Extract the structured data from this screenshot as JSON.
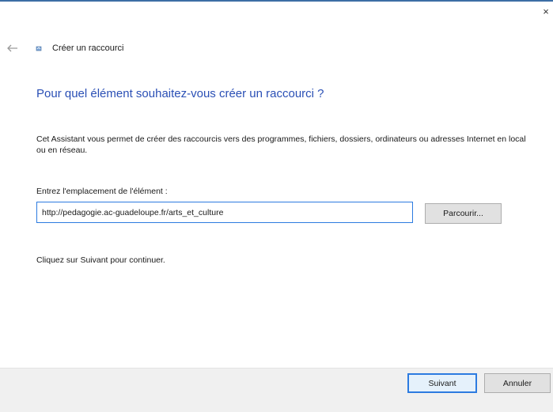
{
  "window": {
    "close_label": "×"
  },
  "nav": {
    "back_icon": "back-arrow-icon",
    "wizard_icon": "shortcut-wizard-icon",
    "title": "Créer un raccourci"
  },
  "main": {
    "heading": "Pour quel élément souhaitez-vous créer un raccourci ?",
    "description": "Cet Assistant vous permet de créer des raccourcis vers des programmes, fichiers, dossiers, ordinateurs ou adresses Internet en local ou en réseau.",
    "location_label": "Entrez l'emplacement de l'élément :",
    "location_value": "http://pedagogie.ac-guadeloupe.fr/arts_et_culture",
    "browse_label": "Parcourir...",
    "hint": "Cliquez sur Suivant pour continuer."
  },
  "footer": {
    "next_label": "Suivant",
    "cancel_label": "Annuler"
  },
  "colors": {
    "accent": "#2c7be0",
    "heading": "#2a4fb5",
    "footer_bg": "#f0f0f0"
  }
}
